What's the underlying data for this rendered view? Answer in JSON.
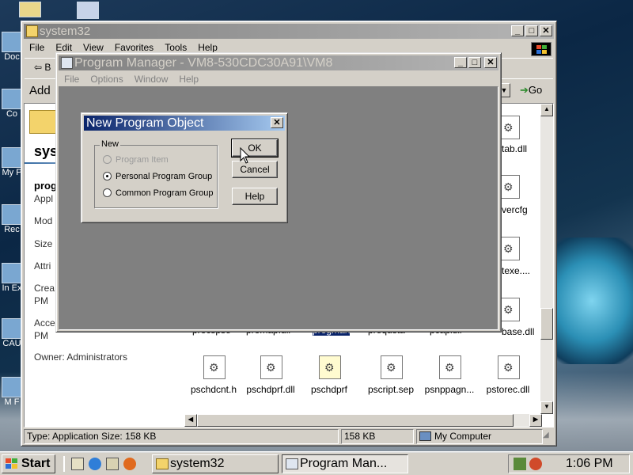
{
  "desktop": {
    "icons": [
      {
        "label": "Doc"
      },
      {
        "label": "Co"
      },
      {
        "label": "My P"
      },
      {
        "label": "Rec"
      },
      {
        "label": "In Ex"
      },
      {
        "label": "CAU"
      },
      {
        "label": "M F"
      }
    ]
  },
  "explorer": {
    "title": "system32",
    "menu": [
      "File",
      "Edit",
      "View",
      "Favorites",
      "Tools",
      "Help"
    ],
    "back_label": "B",
    "address_label": "Add",
    "go_label": "Go",
    "side_panel": {
      "folder_name": "sys",
      "selected_name": "prog",
      "selected_type": "Appl",
      "fields": [
        {
          "label": "Mod"
        },
        {
          "label": "Size"
        },
        {
          "label": "Attri"
        },
        {
          "label": "Crea",
          "value": "PM"
        },
        {
          "label": "Acce",
          "value": "PM"
        }
      ],
      "owner": "Owner: Administrators"
    },
    "right_files": [
      "tab.dll",
      "vercfg",
      "texe....",
      "base.dll"
    ],
    "partial_row": [
      "procspse",
      "promapfull",
      "progman",
      "prequsta",
      "pcapiull"
    ],
    "bottom_files": [
      "pschdcnt.h",
      "pschdprf.dll",
      "pschdprf",
      "pscript.sep",
      "psnppagn...",
      "pstorec.dll"
    ],
    "status": {
      "left": "Type: Application Size: 158 KB",
      "size": "158 KB",
      "zone": "My Computer"
    }
  },
  "program_manager": {
    "title": "Program Manager - VM8-530CDC30A91\\VM8",
    "menu": [
      "File",
      "Options",
      "Window",
      "Help"
    ]
  },
  "dialog": {
    "title": "New Program Object",
    "group_label": "New",
    "options": [
      {
        "label": "Program Item",
        "enabled": false,
        "selected": false
      },
      {
        "label": "Personal Program Group",
        "enabled": true,
        "selected": true
      },
      {
        "label": "Common Program Group",
        "enabled": true,
        "selected": false
      }
    ],
    "ok_label": "OK",
    "cancel_label": "Cancel",
    "help_label": "Help"
  },
  "taskbar": {
    "start_label": "Start",
    "tasks": [
      {
        "label": "system32",
        "active": false
      },
      {
        "label": "Program Man...",
        "active": true
      }
    ],
    "clock": "1:06 PM"
  },
  "icons": {
    "close": "close-icon",
    "minimize": "minimize-icon",
    "maximize": "maximize-icon",
    "folder": "folder-icon",
    "gear_file": "gear-file-icon",
    "windows_logo": "windows-logo-icon"
  }
}
